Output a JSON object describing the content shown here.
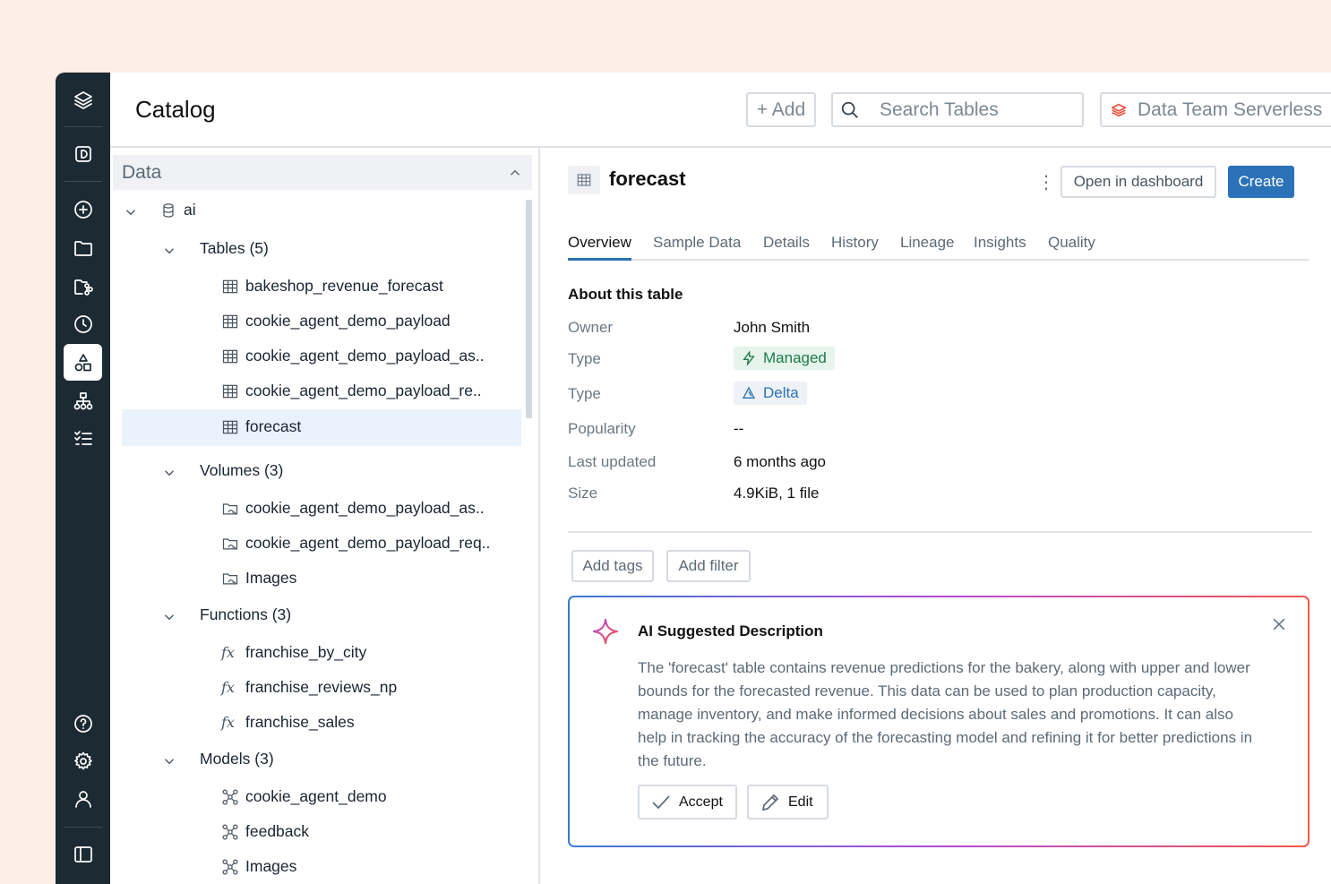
{
  "header": {
    "title": "Catalog",
    "add_label": "+ Add",
    "search_placeholder": "Search Tables",
    "workspace": "Data Team Serverless"
  },
  "rail": {
    "items": [
      "layers-logo-icon",
      "dashboard-d-icon",
      "add-circle-icon",
      "folder-icon",
      "folder-git-icon",
      "history-icon",
      "catalog-shapes-icon",
      "workflows-icon",
      "tasks-list-icon",
      "help-icon",
      "settings-icon",
      "user-icon",
      "sidebar-toggle-icon"
    ],
    "active": "catalog-shapes-icon"
  },
  "tree": {
    "section": "Data",
    "catalog": "ai",
    "groups": {
      "tables": "Tables (5)",
      "volumes": "Volumes (3)",
      "functions": "Functions (3)",
      "models": "Models (3)"
    },
    "tables": [
      "bakeshop_revenue_forecast",
      "cookie_agent_demo_payload",
      "cookie_agent_demo_payload_as..",
      "cookie_agent_demo_payload_re..",
      "forecast"
    ],
    "volumes": [
      "cookie_agent_demo_payload_as..",
      "cookie_agent_demo_payload_req..",
      "Images"
    ],
    "functions": [
      "franchise_by_city",
      "franchise_reviews_np",
      "franchise_sales"
    ],
    "models": [
      "cookie_agent_demo",
      "feedback",
      "Images"
    ],
    "selected": "forecast"
  },
  "detail": {
    "name": "forecast",
    "kebab": "⋮",
    "open_dashboard": "Open in dashboard",
    "create": "Create",
    "tabs": [
      "Overview",
      "Sample Data",
      "Details",
      "History",
      "Lineage",
      "Insights",
      "Quality"
    ],
    "active_tab": "Overview",
    "about": "About this table",
    "props": {
      "owner_k": "Owner",
      "owner_v": "John Smith",
      "type_k": "Type",
      "type_v": "Managed",
      "type2_k": "Type",
      "type2_v": "Delta",
      "pop_k": "Popularity",
      "pop_v": "--",
      "upd_k": "Last updated",
      "upd_v": "6 months ago",
      "size_k": "Size",
      "size_v": "4.9KiB, 1 file"
    },
    "add_tags": "Add tags",
    "add_filter": "Add filter"
  },
  "ai": {
    "title": "AI Suggested Description",
    "text": "The 'forecast' table contains revenue predictions for the bakery, along with upper and lower bounds for the forecasted revenue. This data can be used to plan production capacity, manage inventory, and make informed decisions about sales and promotions. It can also help in tracking the accuracy of the forecasting model and refining it for better predictions in the future.",
    "accept": "Accept",
    "edit": "Edit"
  },
  "colors": {
    "accent": "#2B72B8",
    "rail": "#1B2A33",
    "background": "#FDEFE6",
    "managed": "#1f7a4a"
  }
}
